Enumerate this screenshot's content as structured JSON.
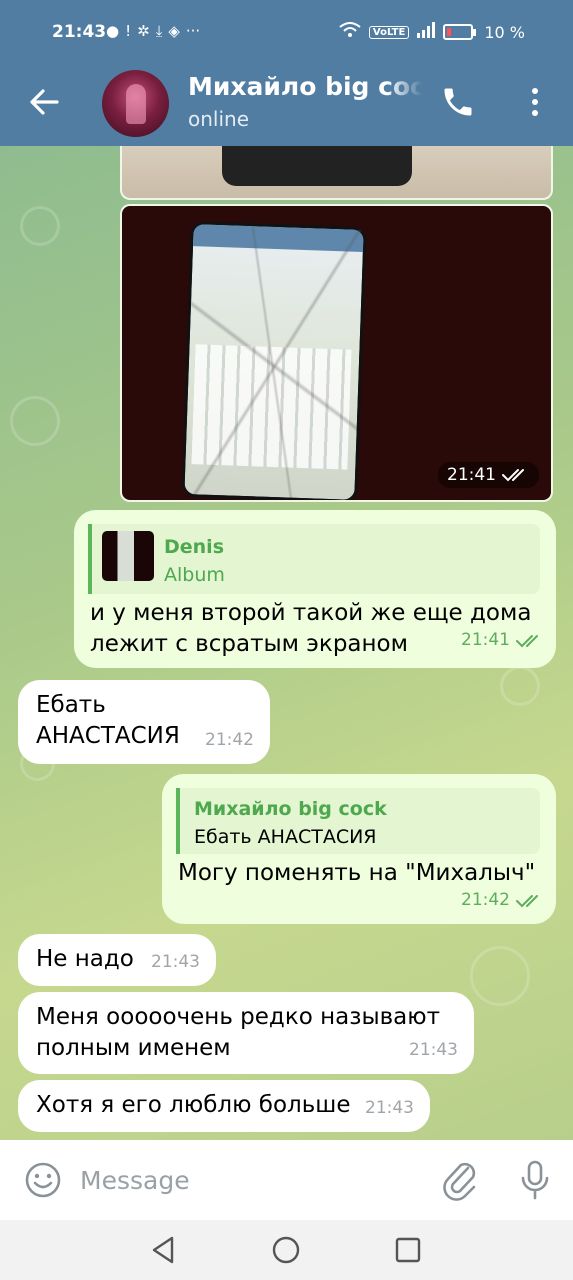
{
  "status_bar": {
    "time": "21:43",
    "battery": "10 %",
    "volte": "VoLTE",
    "left_icons": [
      "chat-bubble-icon",
      "alert-icon",
      "settings-icon",
      "download-icon",
      "shield-icon",
      "more-icon"
    ],
    "right_icons": [
      "wifi-icon",
      "volte-icon",
      "signal-icon",
      "battery-icon"
    ]
  },
  "header": {
    "title": "Михайло big cock",
    "status": "online",
    "icons": [
      "back-arrow-icon",
      "phone-icon",
      "more-vertical-icon"
    ]
  },
  "messages": [
    {
      "type": "photo",
      "time": "",
      "partial": true
    },
    {
      "type": "photo",
      "time": "21:41",
      "read": true
    },
    {
      "type": "outgoing",
      "reply_name": "Denis",
      "reply_text": "Album",
      "text": "и у меня второй такой же еще дома лежит с вратым экраном",
      "time": "21:41",
      "read": true
    },
    {
      "type": "incoming",
      "text": "Ебать АНАСТАСИЯ",
      "time": "21:42"
    },
    {
      "type": "outgoing",
      "reply_name": "Михайло big cock",
      "reply_text": "Ебать АНАСТАСИЯ",
      "text": "Могу поменять на \"Михалыч\"",
      "time": "21:42",
      "read": true
    },
    {
      "type": "incoming",
      "text": "Не надо",
      "time": "21:43"
    },
    {
      "type": "incoming",
      "text": "Меня оооооchень редко называют полным именем",
      "time": "21:43"
    },
    {
      "type": "incoming",
      "text": "Хотя я его люблю больше",
      "time": "21:43"
    }
  ],
  "text": {
    "m3_line1": "и у меня второй такой же еще дома",
    "m3_line2": "лежит с всратым экраном",
    "m4_line1": "Ебать",
    "m4_line2": "АНАСТАСИЯ",
    "m5": "Могу поменять на \"Михалыч\"",
    "m6": "Не надо",
    "m7_line1": "Меня ооооочень редко называют",
    "m7_line2": "полным именем",
    "m8": "Хотя я его люблю больше"
  },
  "input": {
    "placeholder": "Message",
    "icons": [
      "emoji-icon",
      "attach-icon",
      "mic-icon"
    ]
  },
  "nav_bar": {
    "icons": [
      "back-triangle-icon",
      "home-circle-icon",
      "recents-square-icon"
    ]
  },
  "colors": {
    "header": "#517da2",
    "outgoing_bubble": "#effedd",
    "incoming_bubble": "#ffffff",
    "accent_green": "#5bb55a"
  }
}
